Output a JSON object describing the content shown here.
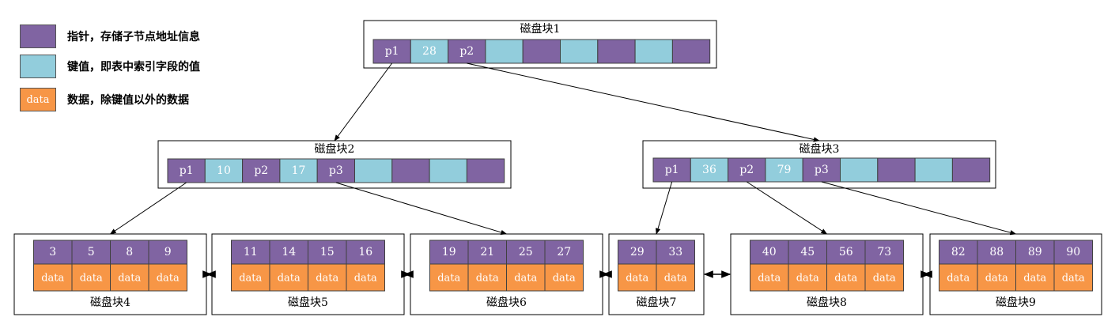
{
  "colors": {
    "pointer": "#8064a2",
    "key": "#92cddc",
    "data": "#f79646",
    "stroke": "#404040",
    "border": "#000000"
  },
  "legend": [
    {
      "kind": "pointer",
      "label": "",
      "text": "指针，存储子节点地址信息"
    },
    {
      "kind": "key",
      "label": "",
      "text": "键值，即表中索引字段的值"
    },
    {
      "kind": "data",
      "label": "data",
      "text": "数据，除键值以外的数据"
    }
  ],
  "internal_nodes": [
    {
      "id": "n1",
      "title": "磁盘块1",
      "cells": [
        "p1",
        "28",
        "p2",
        "",
        "",
        "",
        "",
        "",
        ""
      ]
    },
    {
      "id": "n2",
      "title": "磁盘块2",
      "cells": [
        "p1",
        "10",
        "p2",
        "17",
        "p3",
        "",
        "",
        "",
        ""
      ]
    },
    {
      "id": "n3",
      "title": "磁盘块3",
      "cells": [
        "p1",
        "36",
        "p2",
        "79",
        "p3",
        "",
        "",
        "",
        ""
      ]
    }
  ],
  "leaf_nodes": [
    {
      "id": "n4",
      "title": "磁盘块4",
      "keys": [
        "3",
        "5",
        "8",
        "9"
      ]
    },
    {
      "id": "n5",
      "title": "磁盘块5",
      "keys": [
        "11",
        "14",
        "15",
        "16"
      ]
    },
    {
      "id": "n6",
      "title": "磁盘块6",
      "keys": [
        "19",
        "21",
        "25",
        "27"
      ]
    },
    {
      "id": "n7",
      "title": "磁盘块7",
      "keys": [
        "29",
        "33"
      ]
    },
    {
      "id": "n8",
      "title": "磁盘块8",
      "keys": [
        "40",
        "45",
        "56",
        "73"
      ]
    },
    {
      "id": "n9",
      "title": "磁盘块9",
      "keys": [
        "82",
        "88",
        "89",
        "90"
      ]
    }
  ],
  "data_label": "data",
  "edges": [
    {
      "from": "n1",
      "pointer": "p1",
      "to": "n2"
    },
    {
      "from": "n1",
      "pointer": "p2",
      "to": "n3"
    },
    {
      "from": "n2",
      "pointer": "p1",
      "to": "n4"
    },
    {
      "from": "n2",
      "pointer": "p3",
      "to": "n6"
    },
    {
      "from": "n3",
      "pointer": "p1",
      "to": "n7"
    },
    {
      "from": "n3",
      "pointer": "p2",
      "to": "n8"
    },
    {
      "from": "n3",
      "pointer": "p3",
      "to": "n9"
    }
  ],
  "leaf_links": [
    [
      "n4",
      "n5"
    ],
    [
      "n5",
      "n6"
    ],
    [
      "n6",
      "n7"
    ],
    [
      "n7",
      "n8"
    ],
    [
      "n8",
      "n9"
    ]
  ]
}
